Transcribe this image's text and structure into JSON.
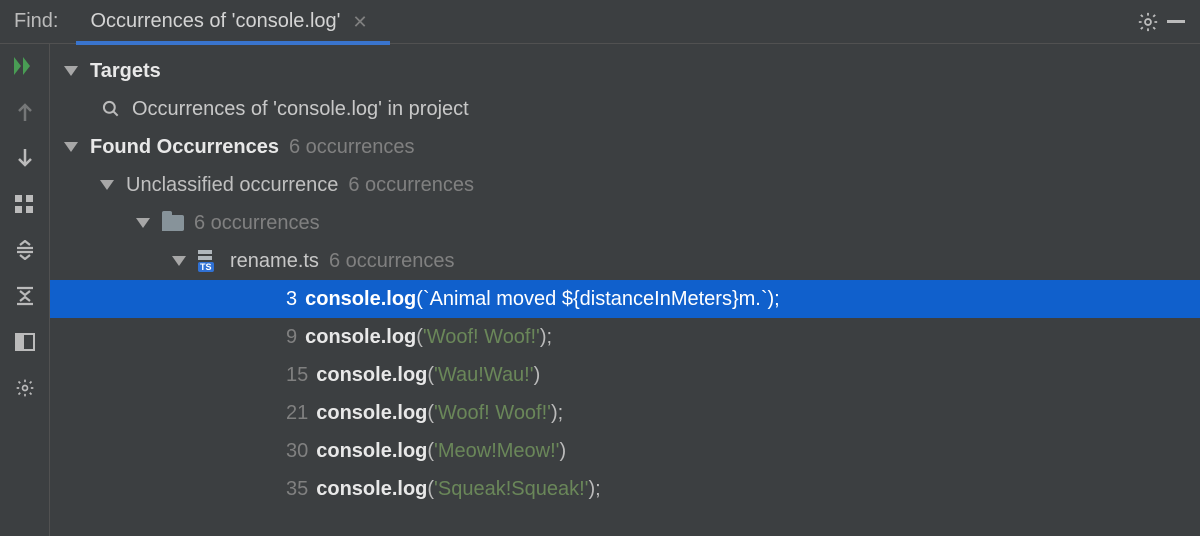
{
  "header": {
    "label": "Find:",
    "tab_title": "Occurrences of 'console.log'"
  },
  "tree": {
    "targets_label": "Targets",
    "targets_scope": "Occurrences of 'console.log' in project",
    "found_label": "Found Occurrences",
    "found_count": "6 occurrences",
    "unclassified_label": "Unclassified occurrence",
    "unclassified_count": "6 occurrences",
    "folder_count": "6 occurrences",
    "file_name": "rename.ts",
    "file_count": "6 occurrences"
  },
  "results": [
    {
      "line": "3",
      "call": "console.log",
      "open": "(",
      "str": "`Animal moved ${distanceInMeters}m.`",
      "close": ");",
      "selected": true
    },
    {
      "line": "9",
      "call": "console.log",
      "open": "(",
      "str": "'Woof! Woof!'",
      "close": ");",
      "selected": false
    },
    {
      "line": "15",
      "call": "console.log",
      "open": "(",
      "str": "'Wau!Wau!'",
      "close": ")",
      "selected": false
    },
    {
      "line": "21",
      "call": "console.log",
      "open": "(",
      "str": "'Woof! Woof!'",
      "close": ");",
      "selected": false
    },
    {
      "line": "30",
      "call": "console.log",
      "open": "(",
      "str": "'Meow!Meow!'",
      "close": ")",
      "selected": false
    },
    {
      "line": "35",
      "call": "console.log",
      "open": "(",
      "str": "'Squeak!Squeak!'",
      "close": ");",
      "selected": false
    }
  ]
}
